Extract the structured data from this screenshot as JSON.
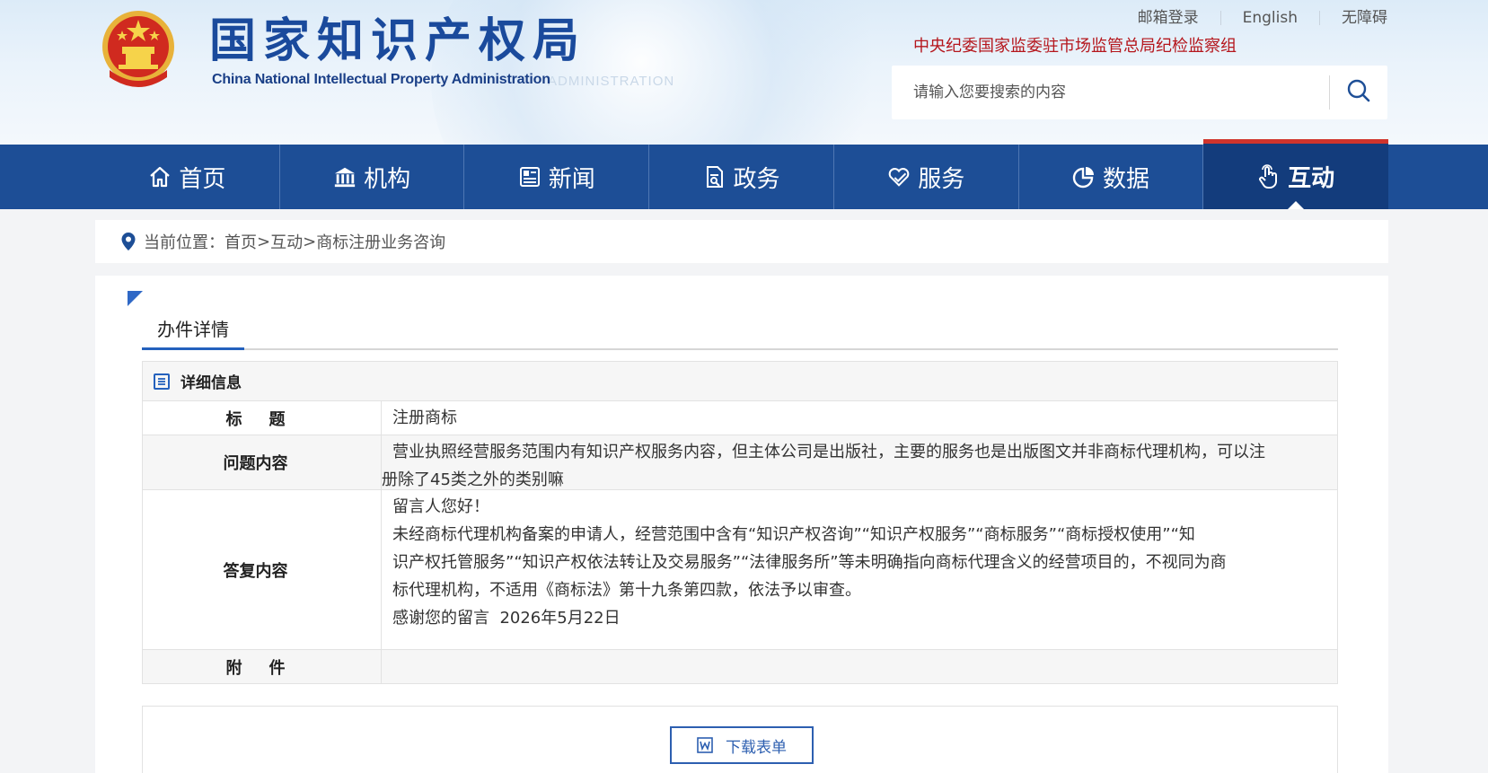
{
  "header": {
    "logo_cn": "国家知识产权局",
    "logo_en": "China National Intellectual Property Administration",
    "watermark": "ADMINISTRATION",
    "top_links": [
      "邮箱登录",
      "English",
      "无障碍"
    ],
    "supervision": "中央纪委国家监委驻市场监管总局纪检监察组",
    "search": {
      "placeholder": "请输入您要搜索的内容",
      "icon": "search-icon"
    }
  },
  "nav": {
    "items": [
      {
        "label": "首页",
        "icon": "home-icon"
      },
      {
        "label": "机构",
        "icon": "institution-icon"
      },
      {
        "label": "新闻",
        "icon": "news-icon"
      },
      {
        "label": "政务",
        "icon": "document-icon"
      },
      {
        "label": "服务",
        "icon": "service-icon"
      },
      {
        "label": "数据",
        "icon": "pie-chart-icon"
      },
      {
        "label": "互动",
        "icon": "hand-icon"
      }
    ],
    "active": "互动",
    "colors": {
      "bar": "#1d4e96",
      "active": "#133c7c",
      "active_accent": "#d0342c"
    }
  },
  "breadcrumb": {
    "prefix": "当前位置：",
    "items": [
      "首页",
      "互动",
      "商标注册业务咨询"
    ],
    "separator": ">"
  },
  "main": {
    "tab_label": "办件详情",
    "detail_title": "详细信息",
    "rows": {
      "title_key": "标题",
      "title_value": "注册商标",
      "question_key": "问题内容",
      "question_line1": "营业执照经营服务范围内有知识产权服务内容，但主体公司是出版社，主要的服务也是出版图文并非商标代理机构，可以注",
      "question_line2": "册除了45类之外的类别嘛",
      "answer_key": "答复内容",
      "answer_greeting": "留言人您好！",
      "answer_line1": "未经商标代理机构备案的申请人，经营范围中含有“知识产权咨询”“知识产权服务”“商标服务”“商标授权使用”“知",
      "answer_line2": "识产权托管服务”“知识产权依法转让及交易服务”“法律服务所”等未明确指向商标代理含义的经营项目的，不视同为商",
      "answer_line3": "标代理机构，不适用《商标法》第十九条第四款，依法予以审查。",
      "answer_closing": "感谢您的留言  2026年5月22日",
      "attachment_key": "附件"
    },
    "download_label": "下载表单"
  }
}
